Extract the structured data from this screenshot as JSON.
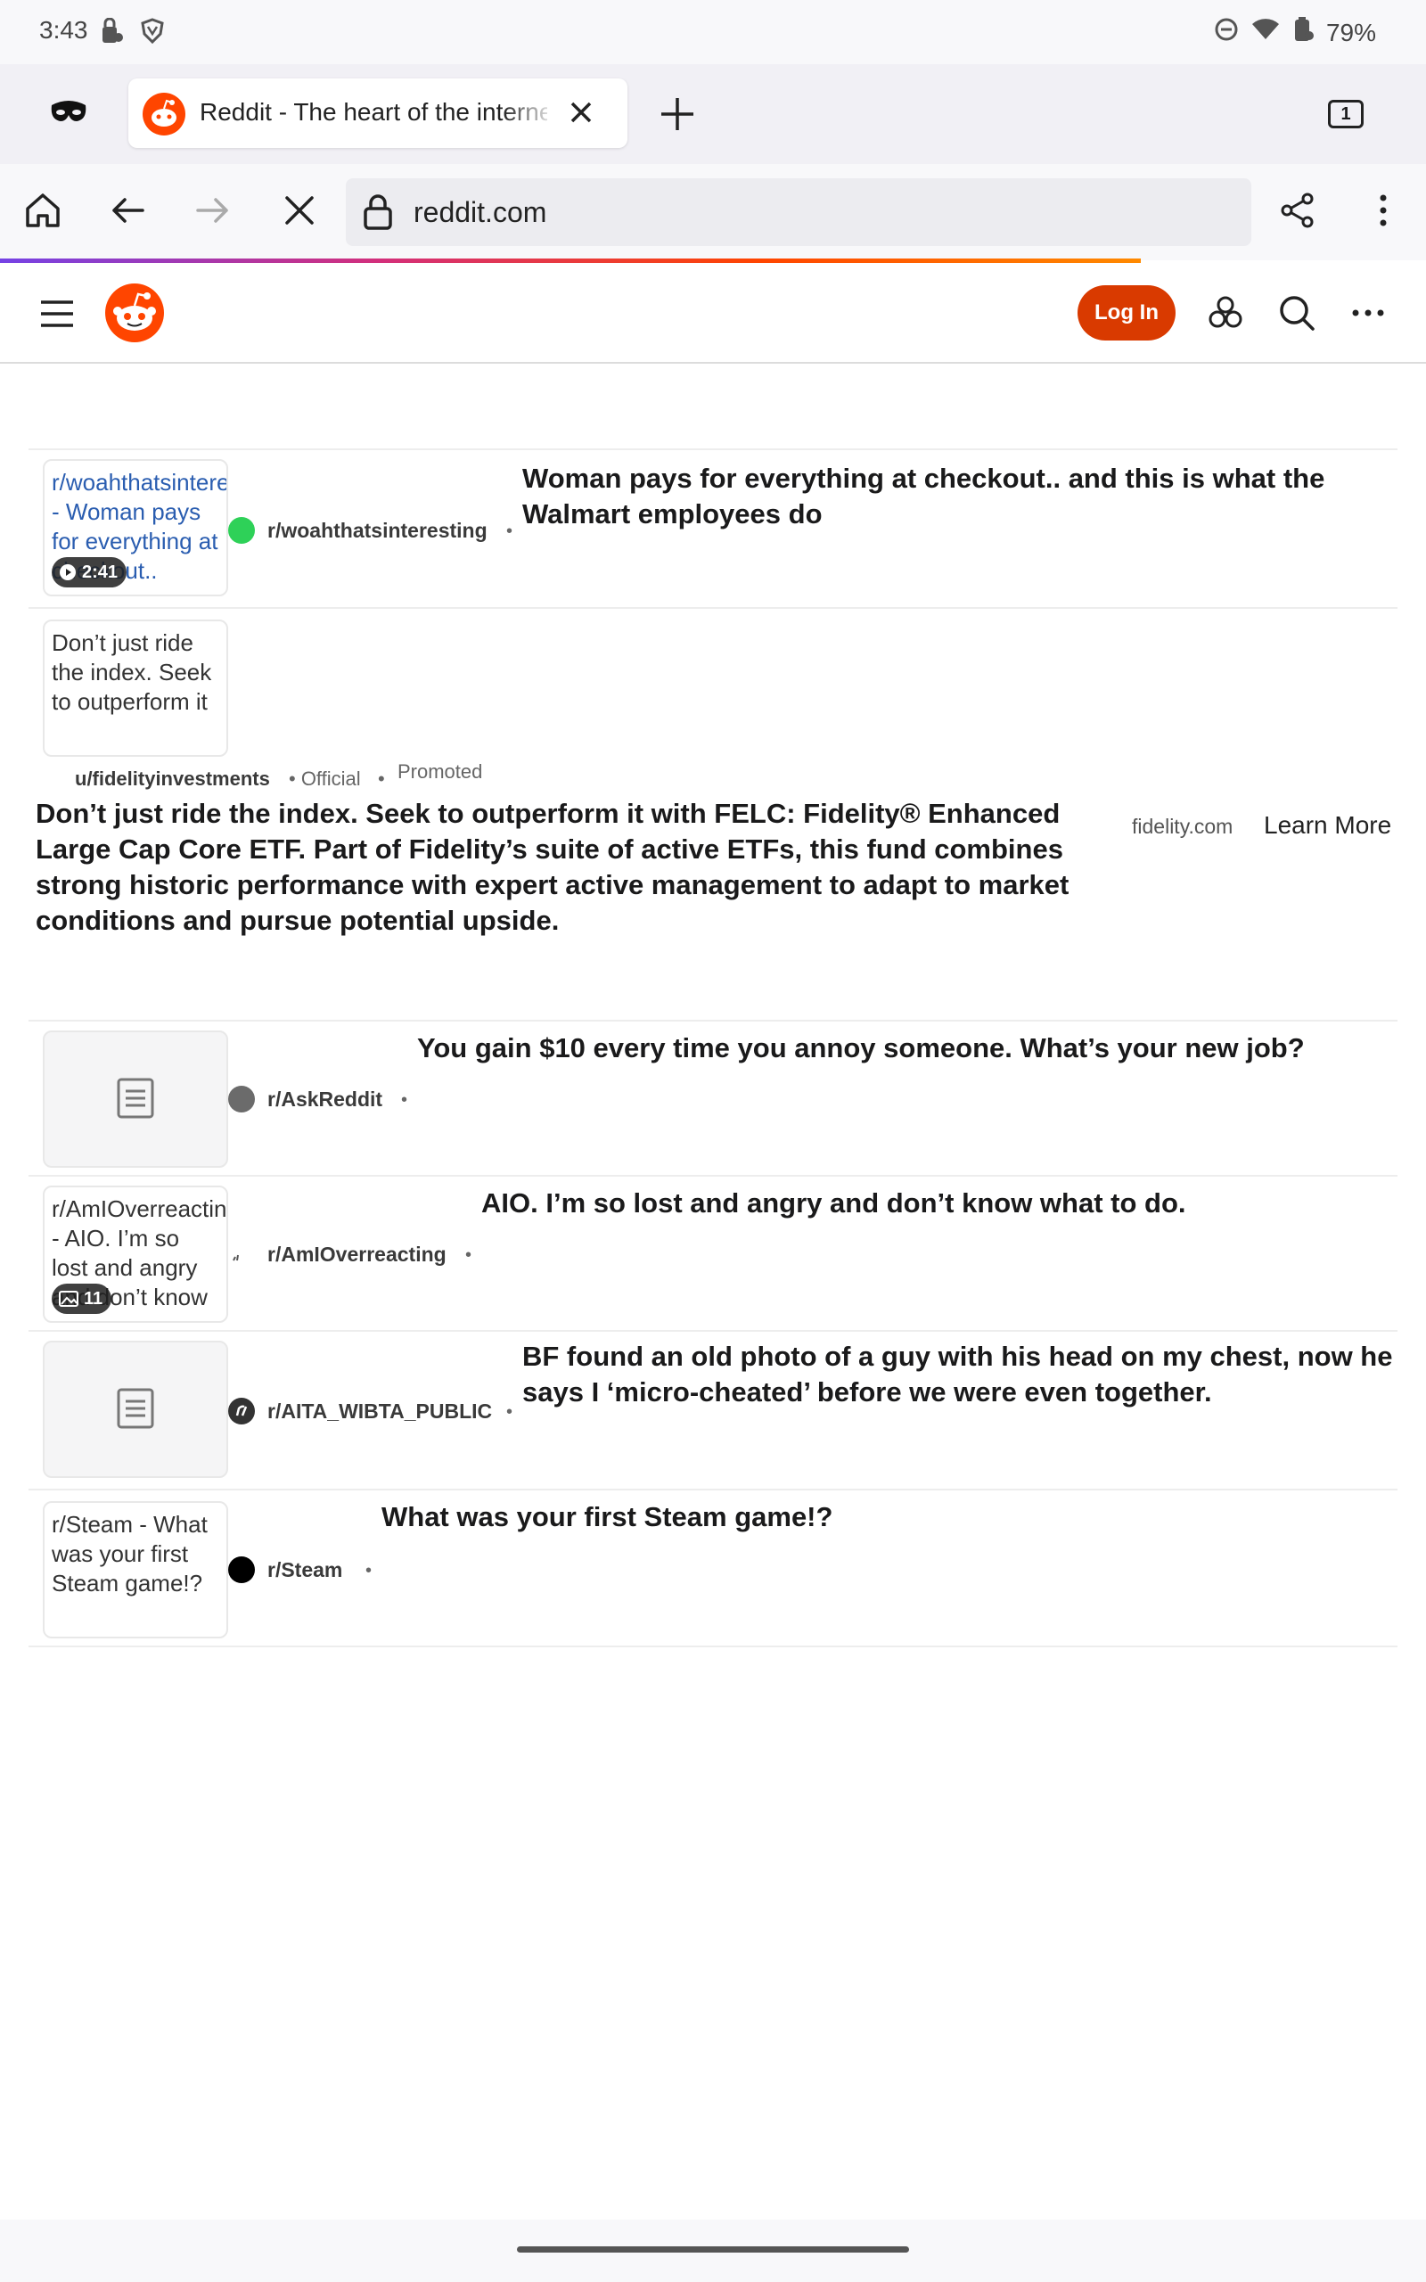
{
  "status_bar": {
    "time": "3:43",
    "battery": "79%",
    "icons": [
      "lock-badge-icon",
      "shield-icon",
      "dnd-icon",
      "wifi-icon",
      "battery-icon"
    ]
  },
  "browser": {
    "tab_title": "Reddit - The heart of the internet",
    "tab_count": "1",
    "url": "reddit.com"
  },
  "reddit_header": {
    "login_label": "Log In"
  },
  "posts": [
    {
      "thumb_text": "r/woahthatsinteresting - Woman pays for everything at checkout..",
      "badge": "2:41",
      "subreddit": "r/woahthatsinteresting",
      "sep": "•",
      "title": "Woman pays for everything at checkout.. and this is what the Walmart employees do"
    },
    {
      "thumb_text": "r/AskReddit",
      "subreddit": "r/AskReddit",
      "sep": "•",
      "title": "You gain $10 every time you annoy someone. What’s your new job?"
    },
    {
      "thumb_text": "r/AmIOverreacting - AIO. I’m so lost and angry and don’t know",
      "badge": "11",
      "subreddit": "r/AmIOverreacting",
      "sep": "•",
      "title": "AIO. I’m so lost and angry and don’t know what to do."
    },
    {
      "subreddit": "r/AITA_WIBTA_PUBLIC",
      "sep": "•",
      "title": "BF found an old photo of a guy with his head on my chest, now he says I ‘micro-cheated’ before we were even together."
    },
    {
      "thumb_text": "r/Steam - What was your first Steam game!?",
      "subreddit": "r/Steam",
      "sep": "•",
      "title": "What was your first Steam game!?"
    }
  ],
  "promoted": {
    "thumb_text": "Don’t just ride the index. Seek to outperform it",
    "user": "u/fidelityinvestments",
    "official": "• Official",
    "dot": "•",
    "label": "Promoted",
    "body": "Don’t just ride the index. Seek to outperform it with FELC: Fidelity® Enhanced Large Cap Core ETF. Part of Fidelity’s suite of active ETFs, this fund combines strong historic performance with expert active management to adapt to market conditions and pursue potential upside.",
    "domain": "fidelity.com",
    "cta": "Learn More"
  },
  "colors": {
    "reddit_orange": "#ff4500",
    "login_button": "#d93a00",
    "woah_dot": "#2ed158",
    "askreddit_dot": "#6b6b6b"
  }
}
